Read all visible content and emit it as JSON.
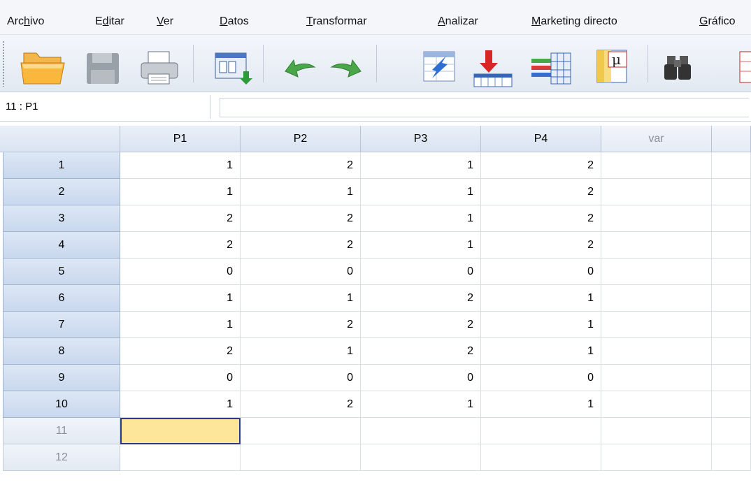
{
  "menu": [
    {
      "pre": "Arc",
      "acc": "h",
      "post": "ivo"
    },
    {
      "pre": "E",
      "acc": "d",
      "post": "itar"
    },
    {
      "pre": "",
      "acc": "V",
      "post": "er"
    },
    {
      "pre": "",
      "acc": "D",
      "post": "atos"
    },
    {
      "pre": "",
      "acc": "T",
      "post": "ransformar"
    },
    {
      "pre": "",
      "acc": "A",
      "post": "nalizar"
    },
    {
      "pre": "",
      "acc": "M",
      "post": "arketing directo"
    },
    {
      "pre": "",
      "acc": "G",
      "post": "ráfico"
    }
  ],
  "toolbar": {
    "icons": [
      "open-folder-icon",
      "save-disk-icon",
      "print-icon",
      "recall-dialog-icon",
      "undo-icon",
      "redo-icon",
      "goto-case-icon",
      "goto-variable-icon",
      "variables-icon",
      "value-labels-icon",
      "find-icon",
      "insert-cases-icon"
    ]
  },
  "refbar": {
    "cell_ref": "11 : P1",
    "cell_value": ""
  },
  "grid": {
    "columns": [
      "P1",
      "P2",
      "P3",
      "P4",
      "var"
    ],
    "rows": [
      {
        "label": "1",
        "values": [
          "1",
          "2",
          "1",
          "2"
        ]
      },
      {
        "label": "2",
        "values": [
          "1",
          "1",
          "1",
          "2"
        ]
      },
      {
        "label": "3",
        "values": [
          "2",
          "2",
          "1",
          "2"
        ]
      },
      {
        "label": "4",
        "values": [
          "2",
          "2",
          "1",
          "2"
        ]
      },
      {
        "label": "5",
        "values": [
          "0",
          "0",
          "0",
          "0"
        ]
      },
      {
        "label": "6",
        "values": [
          "1",
          "1",
          "2",
          "1"
        ]
      },
      {
        "label": "7",
        "values": [
          "1",
          "2",
          "2",
          "1"
        ]
      },
      {
        "label": "8",
        "values": [
          "2",
          "1",
          "2",
          "1"
        ]
      },
      {
        "label": "9",
        "values": [
          "0",
          "0",
          "0",
          "0"
        ]
      },
      {
        "label": "10",
        "values": [
          "1",
          "2",
          "1",
          "1"
        ]
      },
      {
        "label": "11",
        "values": [
          "",
          "",
          "",
          ""
        ]
      },
      {
        "label": "12",
        "values": [
          "",
          "",
          "",
          ""
        ]
      }
    ],
    "active_row": 10,
    "active_col": 0
  },
  "colors": {
    "active_cell": "#fde59a",
    "row_header": "#c9d8ee",
    "accent_border": "#2b3a8c"
  }
}
